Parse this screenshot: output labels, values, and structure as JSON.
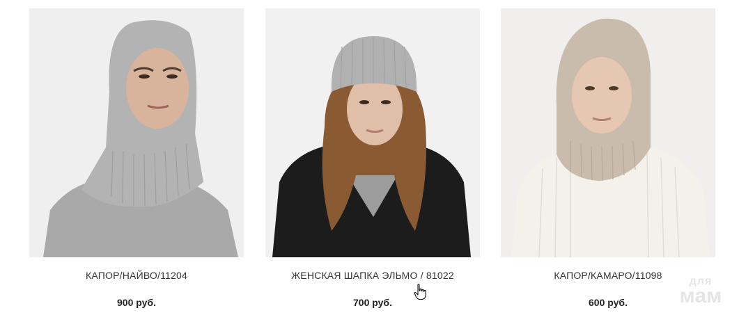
{
  "products": [
    {
      "title": "КАПОР/НАЙВО/11204",
      "price": "900 руб.",
      "image": "model-grey-hood-balaclava"
    },
    {
      "title": "ЖЕНСКАЯ ШАПКА ЭЛЬМО / 81022",
      "price": "700 руб.",
      "image": "model-grey-beanie-black-coat"
    },
    {
      "title": "КАПОР/КАМАРО/11098",
      "price": "600 руб.",
      "image": "model-beige-hood-white-sweater"
    }
  ],
  "watermark": {
    "line1": "для",
    "line2": "мам"
  },
  "colors": {
    "text": "#333333",
    "price": "#222222",
    "photo_bg": "#efefef"
  }
}
